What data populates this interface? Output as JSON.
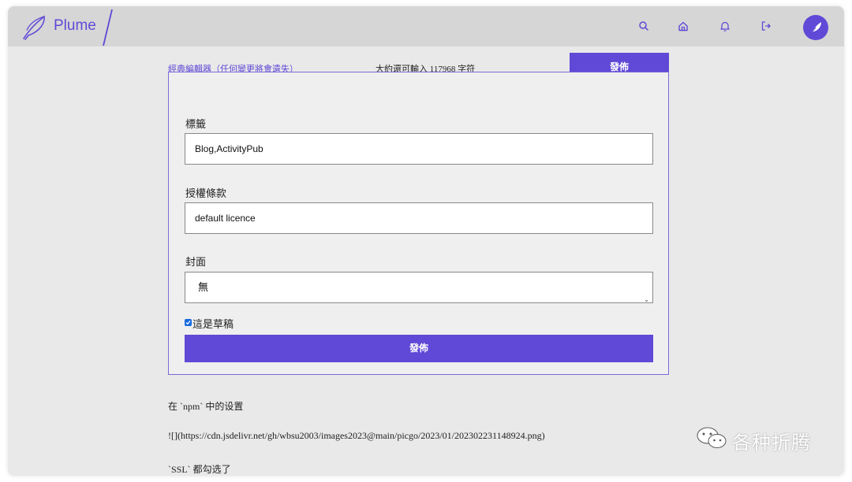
{
  "header": {
    "brand": "Plume",
    "nav": [
      {
        "name": "search",
        "icon": "search-icon"
      },
      {
        "name": "home",
        "icon": "home-icon"
      },
      {
        "name": "notifications",
        "icon": "bell-icon"
      },
      {
        "name": "logout",
        "icon": "logout-icon"
      }
    ],
    "avatar_icon": "feather-icon",
    "accent": "#6049d6"
  },
  "editor": {
    "classic_link": "經典編輯器（任何變更將會遺失）",
    "chars_left": "大約還可輸入 117968 字符",
    "publish_top": "發佈"
  },
  "form": {
    "tags_label": "標籤",
    "tags_value": "Blog,ActivityPub",
    "license_label": "授權條款",
    "license_value": "default licence",
    "cover_label": "封面",
    "cover_value": "無",
    "draft_label": "這是草稿",
    "draft_checked": true,
    "publish_button": "發佈"
  },
  "article_body": [
    "在 `npm` 中的设置",
    "![](https://cdn.jsdelivr.net/gh/wbsu2003/images2023@main/picgo/2023/01/202302231148924.png)",
    "`SSL` 都勾选了"
  ],
  "watermark": {
    "text": "各种折腾",
    "icon": "wechat-icon"
  }
}
